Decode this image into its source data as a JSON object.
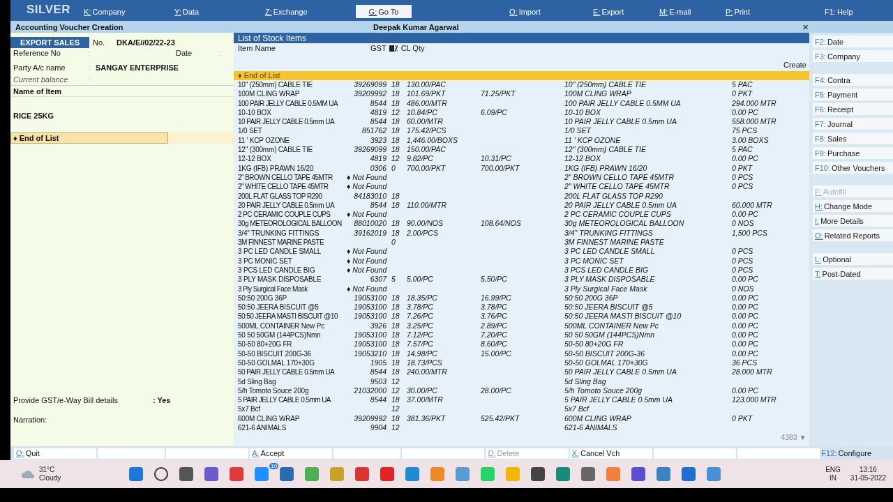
{
  "brand": "SILVER",
  "menu": [
    {
      "key": "K:",
      "label": "Company",
      "selected": false
    },
    {
      "key": "Y:",
      "label": "Data",
      "selected": false
    },
    {
      "key": "Z:",
      "label": "Exchange",
      "selected": false
    },
    {
      "key": "G:",
      "label": "Go To",
      "selected": true
    },
    {
      "key": "O:",
      "label": "Import",
      "selected": false
    },
    {
      "key": "E:",
      "label": "Export",
      "selected": false
    },
    {
      "key": "M:",
      "label": "E-mail",
      "selected": false
    },
    {
      "key": "P:",
      "label": "Print",
      "selected": false
    },
    {
      "key": "F1:",
      "label": "Help",
      "selected": false
    }
  ],
  "header": {
    "title": "Accounting Voucher Creation",
    "company": "Deepak Kumar Agarwal",
    "close": "×"
  },
  "voucher": {
    "type": "EXPORT SALES",
    "no_label": "No.",
    "no": "DKA/E//02/22-23",
    "reference_label": "Reference No",
    "reference_sep": ":",
    "date_label": "Date",
    "date_sep": ":",
    "party_label": "Party A/c name",
    "party_sep": ":",
    "party": "SANGAY ENTERPRISE",
    "balance_label": "Current balance",
    "balance_sep": ":",
    "item_heading": "Name of Item",
    "item": "RICE  25KG",
    "end_of_list": "♦ End of List",
    "gst_label": "Provide GST/e-Way Bill details",
    "gst_value": ": Yes",
    "narration_label": "Narration:"
  },
  "stock_list": {
    "title": "List of Stock Items",
    "columns": [
      "Item Name",
      "GST",
      "CL Qty"
    ],
    "create": "Create",
    "end_of_list": "♦ End of List",
    "count": "4383 ▼",
    "rows": [
      {
        "name": "10\" (250mm) CABLE TIE",
        "hsn": "39269099",
        "gst": "18",
        "rate": "130.00/PAC",
        "alias": "10\" (250mm) CABLE TIE",
        "qty": "5 PAC"
      },
      {
        "name": "100M CLING WRAP",
        "hsn": "39209992",
        "gst": "18",
        "rate": "101.69/PKT",
        "last_rate": "71.25/PKT",
        "alias": "100M CLING WRAP",
        "qty": "0 PKT"
      },
      {
        "name": "100 PAIR JELLY CABLE 0.5MM UA",
        "hsn": "8544",
        "gst": "18",
        "rate": "486.00/MTR",
        "alias": "100 PAIR JELLY CABLE 0.5MM UA",
        "qty": "294.000 MTR"
      },
      {
        "name": "10-10 BOX",
        "hsn": "4819",
        "gst": "12",
        "rate": "10.84/PC",
        "last_rate": "6.09/PC",
        "alias": "10-10 BOX",
        "qty": "0.00 PC"
      },
      {
        "name": "10 PAIR JELLY CABLE 0.5mm UA",
        "hsn": "8544",
        "gst": "18",
        "rate": "60.00/MTR",
        "alias": "10 PAIR JELLY CABLE 0.5mm UA",
        "qty": "558.000 MTR"
      },
      {
        "name": "1/0 SET",
        "hsn": "851762",
        "gst": "18",
        "rate": "175.42/PCS",
        "alias": "1/0 SET",
        "qty": "75 PCS"
      },
      {
        "name": "11 ' KCP OZONE",
        "hsn": "3923",
        "gst": "18",
        "rate": "1,446.00/BOXS",
        "alias": "11 ' KCP OZONE",
        "qty": "3.00 BOXS"
      },
      {
        "name": "12\" (300mm) CABLE TIE",
        "hsn": "39269099",
        "gst": "18",
        "rate": "150.00/PAC",
        "alias": "12\" (300mm) CABLE TIE",
        "qty": "5 PAC"
      },
      {
        "name": "12-12 BOX",
        "hsn": "4819",
        "gst": "12",
        "rate": "9.82/PC",
        "last_rate": "10.31/PC",
        "alias": "12-12 BOX",
        "qty": "0.00 PC"
      },
      {
        "name": "1KG (IFB) PRAWN 16/20",
        "hsn": "0306",
        "gst": "0",
        "rate": "700.00/PKT",
        "last_rate": "700.00/PKT",
        "alias": "1KG (IFB) PRAWN 16/20",
        "qty": "0 PKT"
      },
      {
        "name": "2\" BROWN CELLO TAPE 45MTR",
        "hsn": "♦ Not Found",
        "alias": "2\" BROWN CELLO TAPE 45MTR",
        "qty": "0 PCS"
      },
      {
        "name": "2\" WHITE CELLO TAPE 45MTR",
        "hsn": "♦ Not Found",
        "alias": "2\" WHITE CELLO TAPE 45MTR",
        "qty": "0 PCS"
      },
      {
        "name": "200L FLAT GLASS TOP R290",
        "hsn": "84183010",
        "gst": "18",
        "alias": "200L FLAT GLASS TOP R290"
      },
      {
        "name": "20 PAIR JELLY CABLE 0.5mm UA",
        "hsn": "8544",
        "gst": "18",
        "rate": "110.00/MTR",
        "alias": "20 PAIR JELLY CABLE 0.5mm UA",
        "qty": "60.000 MTR"
      },
      {
        "name": "2 PC CERAMIC COUPLE CUPS",
        "hsn": "♦ Not Found",
        "alias": "2 PC CERAMIC COUPLE CUPS",
        "qty": "0.00 PC"
      },
      {
        "name": "30g METEOROLOGICAL BALLOON",
        "hsn": "88010020",
        "gst": "18",
        "rate": "90.00/NOS",
        "last_rate": "108.64/NOS",
        "alias": "30g METEOROLOGICAL BALLOON",
        "qty": "0 NOS"
      },
      {
        "name": "3/4\" TRUNKING FITTINGS",
        "hsn": "39162019",
        "gst": "18",
        "rate": "2.00/PCS",
        "alias": "3/4\" TRUNKING FITTINGS",
        "qty": "1,500 PCS"
      },
      {
        "name": "3M FINNEST MARINE PASTE",
        "gst": "0",
        "alias": "3M FINNEST MARINE PASTE"
      },
      {
        "name": "3 PC LED CANDLE SMALL",
        "hsn": "♦ Not Found",
        "alias": "3 PC LED CANDLE SMALL",
        "qty": "0 PCS"
      },
      {
        "name": "3 PC  MONIC SET",
        "hsn": "♦ Not Found",
        "alias": "3 PC  MONIC SET",
        "qty": "0 PCS"
      },
      {
        "name": "3 PCS LED CANDLE BIG",
        "hsn": "♦ Not Found",
        "alias": "3 PCS LED CANDLE BIG",
        "qty": "0 PCS"
      },
      {
        "name": "3 PLY MASK DISPOSABLE",
        "hsn": "6307",
        "gst": "5",
        "rate": "5.00/PC",
        "last_rate": "5.50/PC",
        "alias": "3 PLY MASK DISPOSABLE",
        "qty": "0.00 PC"
      },
      {
        "name": "3 Ply Surgical Face Mask",
        "hsn": "♦ Not Found",
        "alias": "3 Ply Surgical Face Mask",
        "qty": "0 NOS"
      },
      {
        "name": "50:50  200G 36P",
        "hsn": "19053100",
        "gst": "18",
        "rate": "18.35/PC",
        "last_rate": "16.99/PC",
        "alias": "50:50  200G 36P",
        "qty": "0.00 PC"
      },
      {
        "name": "50:50 JEERA BISCUIT @5",
        "hsn": "19053100",
        "gst": "18",
        "rate": "3.78/PC",
        "last_rate": "3.78/PC",
        "alias": "50:50 JEERA BISCUIT @5",
        "qty": "0.00 PC"
      },
      {
        "name": "50:50 JEERA MASTI BISCUIT @10",
        "hsn": "19053100",
        "gst": "18",
        "rate": "7.26/PC",
        "last_rate": "3.76/PC",
        "alias": "50:50 JEERA MASTI BISCUIT @10",
        "qty": "0.00 PC"
      },
      {
        "name": "500ML CONTAINER New Pc",
        "hsn": "3926",
        "gst": "18",
        "rate": "3.25/PC",
        "last_rate": "2.89/PC",
        "alias": "500ML CONTAINER New Pc",
        "qty": "0.00 PC"
      },
      {
        "name": "50 50 50GM (144PCS)Nmn",
        "hsn": "19053100",
        "gst": "18",
        "rate": "7.12/PC",
        "last_rate": "7.20/PC",
        "alias": "50 50 50GM (144PCS)Nmn",
        "qty": "0.00 PC"
      },
      {
        "name": "50-50 80+20G FR",
        "hsn": "19053100",
        "gst": "18",
        "rate": "7.57/PC",
        "last_rate": "8.60/PC",
        "alias": "50-50 80+20G FR",
        "qty": "0.00 PC"
      },
      {
        "name": "50-50 BISCUIT 200G-36",
        "hsn": "19053210",
        "gst": "18",
        "rate": "14.98/PC",
        "last_rate": "15.00/PC",
        "alias": "50-50 BISCUIT 200G-36",
        "qty": "0.00 PC"
      },
      {
        "name": "50-50 GOLMAL 170+30G",
        "hsn": "1905",
        "gst": "18",
        "rate": "18.73/PCS",
        "alias": "50-50 GOLMAL 170+30G",
        "qty": "36 PCS"
      },
      {
        "name": "50 PAIR JELLY CABLE 0.5mm UA",
        "hsn": "8544",
        "gst": "18",
        "rate": "240.00/MTR",
        "alias": "50 PAIR JELLY CABLE 0.5mm UA",
        "qty": "28.000 MTR"
      },
      {
        "name": "5d Sling Bag",
        "hsn": "9503",
        "gst": "12",
        "alias": "5d Sling Bag"
      },
      {
        "name": "5/h Tomoto Souce 200g",
        "hsn": "21032000",
        "gst": "12",
        "rate": "30.00/PC",
        "last_rate": "28.00/PC",
        "alias": "5/h Tomoto Souce 200g",
        "qty": "0.00 PC"
      },
      {
        "name": "5 PAIR JELLY CABLE 0.5mm UA",
        "hsn": "8544",
        "gst": "18",
        "rate": "37.00/MTR",
        "alias": "5 PAIR JELLY CABLE 0.5mm UA",
        "qty": "123.000 MTR"
      },
      {
        "name": "5x7 Bcf",
        "gst": "12",
        "alias": "5x7 Bcf"
      },
      {
        "name": "600M CLING WRAP",
        "hsn": "39209992",
        "gst": "18",
        "rate": "381.36/PKT",
        "last_rate": "525.42/PKT",
        "alias": "600M CLING WRAP",
        "qty": "0 PKT"
      },
      {
        "name": "621-6 ANIMALS",
        "hsn": "9904",
        "gst": "12",
        "alias": "621-6 ANIMALS"
      }
    ]
  },
  "sidebar": {
    "groups": [
      {
        "items": [
          {
            "key": "F2:",
            "label": "Date",
            "disabled": false
          },
          {
            "key": "F3:",
            "label": "Company",
            "disabled": false
          }
        ]
      },
      {
        "items": [
          {
            "key": "F4:",
            "label": "Contra",
            "disabled": false
          },
          {
            "key": "F5:",
            "label": "Payment",
            "disabled": false
          },
          {
            "key": "F6:",
            "label": "Receipt",
            "disabled": false
          },
          {
            "key": "F7:",
            "label": "Journal",
            "disabled": false
          },
          {
            "key": "F8:",
            "label": "Sales",
            "disabled": false
          },
          {
            "key": "F9:",
            "label": "Purchase",
            "disabled": false
          },
          {
            "key": "F10:",
            "label": "Other Vouchers",
            "disabled": false
          }
        ]
      },
      {
        "items": [
          {
            "key": "F:",
            "label": "Autofill",
            "disabled": true
          },
          {
            "key": "H:",
            "label": "Change Mode",
            "disabled": false
          },
          {
            "key": "I:",
            "label": "More Details",
            "disabled": false
          },
          {
            "key": "O:",
            "label": "Related Reports",
            "disabled": false
          }
        ]
      },
      {
        "items": [
          {
            "key": "L:",
            "label": "Optional",
            "disabled": false
          },
          {
            "key": "T:",
            "label": "Post-Dated",
            "disabled": false
          }
        ]
      }
    ]
  },
  "bottom_bar": [
    {
      "kind": "action",
      "key": "Q:",
      "label": "Quit",
      "disabled": false
    },
    {
      "kind": "blank"
    },
    {
      "kind": "blank"
    },
    {
      "kind": "action",
      "key": "A:",
      "label": "Accept",
      "disabled": false
    },
    {
      "kind": "blank"
    },
    {
      "kind": "blank"
    },
    {
      "kind": "action",
      "key": "D:",
      "label": "Delete",
      "disabled": true
    },
    {
      "kind": "action",
      "key": "X:",
      "label": "Cancel Vch",
      "disabled": false
    },
    {
      "kind": "blank"
    },
    {
      "kind": "blank"
    },
    {
      "kind": "action",
      "key": "F12:",
      "label": "Configure",
      "disabled": false
    }
  ],
  "taskbar": {
    "temperature": "31°C",
    "weather": "Cloudy",
    "mail_badge": "10",
    "language": "ENG",
    "region": "IN",
    "time": "13:16",
    "date": "31-05-2022"
  }
}
